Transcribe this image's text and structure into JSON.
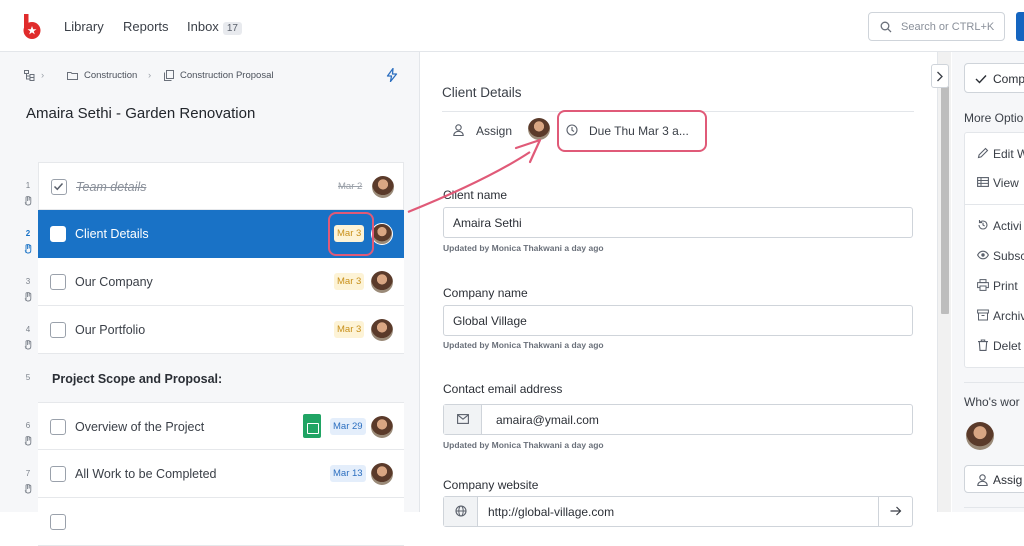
{
  "nav": {
    "library": "Library",
    "reports": "Reports",
    "inbox": "Inbox",
    "inbox_count": "17",
    "search_placeholder": "Search or CTRL+K"
  },
  "breadcrumb": {
    "first": "Construction",
    "second": "Construction Proposal"
  },
  "page_title": "Amaira Sethi - Garden Renovation",
  "sections": [
    {
      "num": "1",
      "label": "Team details",
      "date": "Mar 2",
      "state": "done"
    },
    {
      "num": "2",
      "label": "Client Details",
      "date": "Mar 3",
      "state": "active"
    },
    {
      "num": "3",
      "label": "Our Company",
      "date": "Mar 3",
      "state": "normal"
    },
    {
      "num": "4",
      "label": "Our Portfolio",
      "date": "Mar 3",
      "state": "normal"
    },
    {
      "num": "5",
      "label": "Project Scope and Proposal:",
      "state": "heading"
    },
    {
      "num": "6",
      "label": "Overview of the Project",
      "date": "Mar 29",
      "state": "normal"
    },
    {
      "num": "7",
      "label": "All Work to be Completed",
      "date": "Mar 13",
      "state": "normal"
    }
  ],
  "main": {
    "section_title": "Client Details",
    "assign": "Assign",
    "due": "Due Thu Mar 3 a...",
    "fields": [
      {
        "label": "Client name",
        "value": "Amaira Sethi",
        "note_prefix": "Updated by ",
        "note_user": "Monica Thakwani",
        "note_time": " a day ago"
      },
      {
        "label": "Company name",
        "value": "Global Village",
        "note_prefix": "Updated by ",
        "note_user": "Monica Thakwani",
        "note_time": " a day ago"
      },
      {
        "label": "Contact email address",
        "value": "amaira@ymail.com",
        "note_prefix": "Updated by ",
        "note_user": "Monica Thakwani",
        "note_time": " a day ago"
      },
      {
        "label": "Company website",
        "value": "http://global-village.com"
      }
    ]
  },
  "right": {
    "complete": "Comp",
    "more_options": "More Optio",
    "items_a": [
      "Edit W",
      "View"
    ],
    "items_b": [
      "Activi",
      "Subsc",
      "Print",
      "Archiv",
      "Delet"
    ],
    "whos_working": "Who's wor",
    "assign": "Assig"
  },
  "colors": {
    "accent": "#1972c6",
    "highlight": "#e05a78",
    "brand": "#e02b2b"
  }
}
